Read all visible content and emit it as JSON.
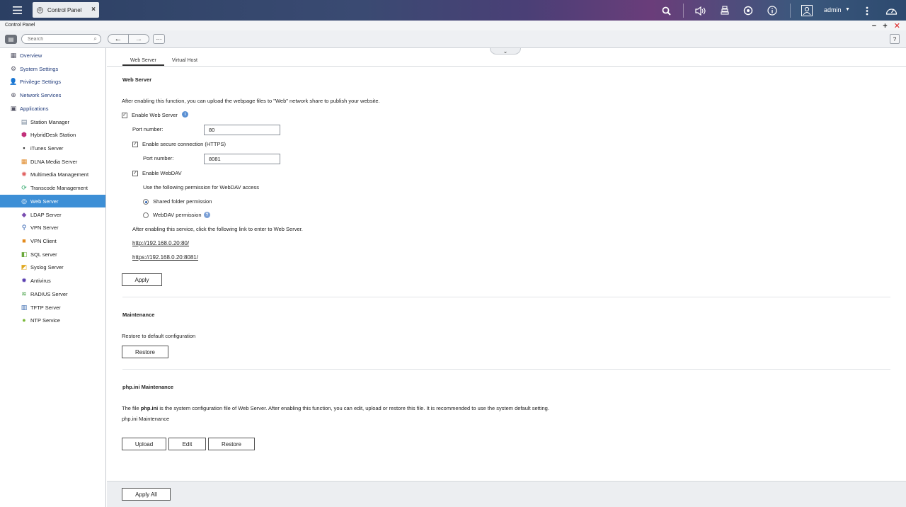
{
  "topbar": {
    "app_tab_label": "Control Panel",
    "user_name": "admin",
    "icons": [
      "menu-icon",
      "search-icon",
      "volume-icon",
      "stack-icon",
      "sync-icon",
      "info-icon",
      "user-icon",
      "more-icon",
      "dashboard-icon"
    ]
  },
  "window": {
    "title": "Control Panel",
    "search_placeholder": "Search"
  },
  "sidebar": {
    "top_items": [
      {
        "label": "Overview",
        "icon": "overview-icon"
      },
      {
        "label": "System Settings",
        "icon": "gear-icon"
      },
      {
        "label": "Privilege Settings",
        "icon": "user-icon"
      },
      {
        "label": "Network Services",
        "icon": "network-icon"
      },
      {
        "label": "Applications",
        "icon": "applications-icon"
      }
    ],
    "sub_items": [
      {
        "label": "Station Manager",
        "color": "#6a7c92"
      },
      {
        "label": "HybridDesk Station",
        "color": "#c2307a"
      },
      {
        "label": "iTunes Server",
        "color": "#333333"
      },
      {
        "label": "DLNA Media Server",
        "color": "#e08a2a"
      },
      {
        "label": "Multimedia Management",
        "color": "#e05c5c"
      },
      {
        "label": "Transcode Management",
        "color": "#2ea86a"
      },
      {
        "label": "Web Server",
        "color": "#3d8fd6"
      },
      {
        "label": "LDAP Server",
        "color": "#7a4db0"
      },
      {
        "label": "VPN Server",
        "color": "#2d5fb0"
      },
      {
        "label": "VPN Client",
        "color": "#e38a1c"
      },
      {
        "label": "SQL server",
        "color": "#6aa83a"
      },
      {
        "label": "Syslog Server",
        "color": "#e0a820"
      },
      {
        "label": "Antivirus",
        "color": "#5a3fb0"
      },
      {
        "label": "RADIUS Server",
        "color": "#3a9a3a"
      },
      {
        "label": "TFTP Server",
        "color": "#3a6ab0"
      },
      {
        "label": "NTP Service",
        "color": "#7ab83a"
      }
    ],
    "active": "Web Server"
  },
  "main": {
    "tabs": [
      "Web Server",
      "Virtual Host"
    ],
    "web_server": {
      "title": "Web Server",
      "description": "After enabling this function, you can upload the webpage files to \"Web\" network share to publish your website.",
      "enable_label": "Enable Web Server",
      "port_label": "Port number:",
      "port_value": "80",
      "https_label": "Enable secure connection (HTTPS)",
      "https_port_label": "Port number:",
      "https_port_value": "8081",
      "webdav_label": "Enable WebDAV",
      "webdav_desc": "Use the following permission for WebDAV access",
      "radio_shared": "Shared folder permission",
      "radio_webdav": "WebDAV permission",
      "link_intro": "After enabling this service, click the following link to enter to Web Server.",
      "link_http": "http://192.168.0.20:80/",
      "link_https": "https://192.168.0.20:8081/",
      "apply": "Apply"
    },
    "maintenance": {
      "title": "Maintenance",
      "desc": "Restore to default configuration",
      "restore": "Restore"
    },
    "php": {
      "title": "php.ini Maintenance",
      "desc_pre": "The file ",
      "desc_bold": "php.ini",
      "desc_post": " is the system configuration file of Web Server. After enabling this function, you can edit, upload or restore this file. It is recommended to use the system default setting.",
      "sub": "php.ini Maintenance",
      "upload": "Upload",
      "edit": "Edit",
      "restore": "Restore"
    }
  },
  "footer": {
    "apply_all": "Apply All"
  }
}
